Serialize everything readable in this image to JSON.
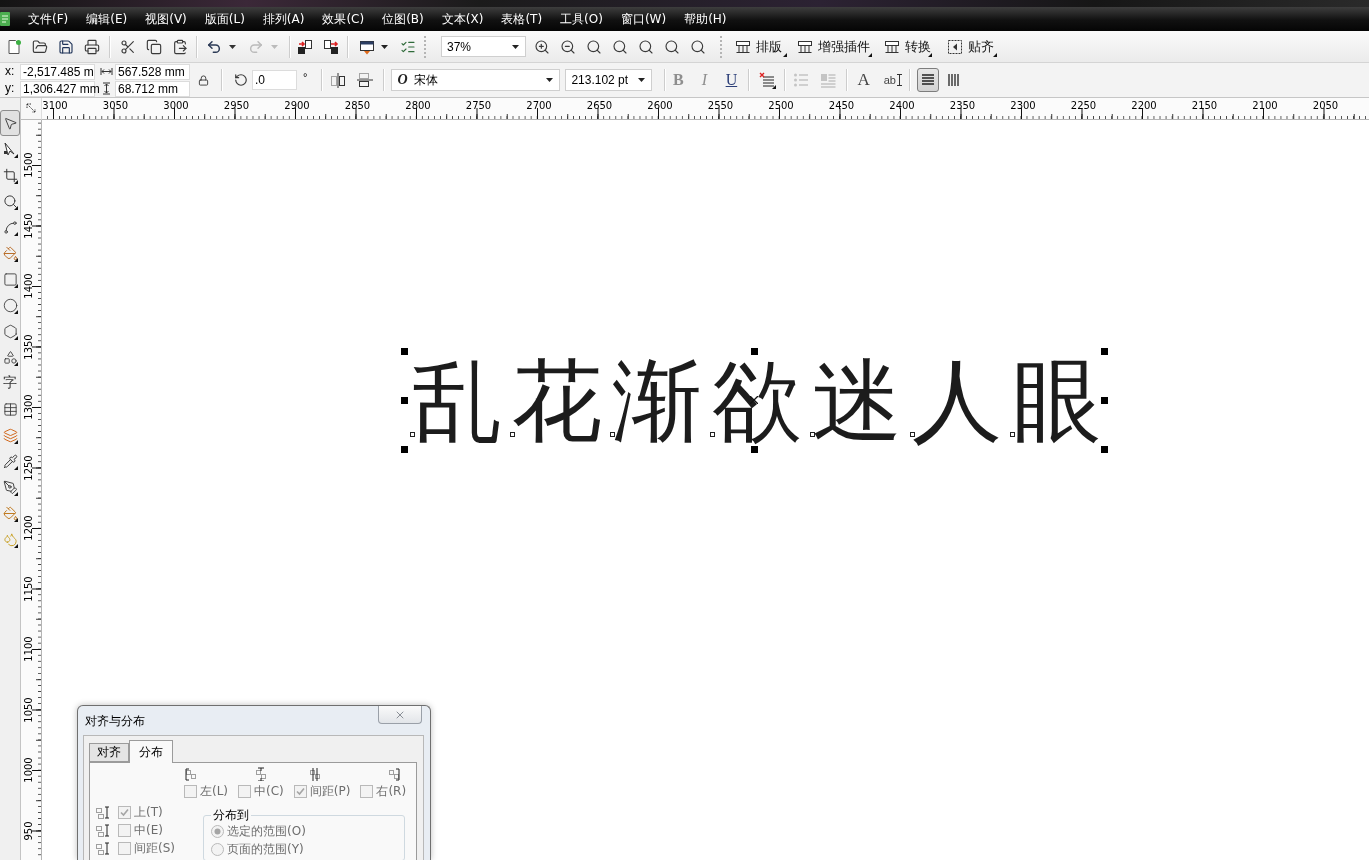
{
  "menu_bar": {
    "items": [
      "文件(F)",
      "编辑(E)",
      "视图(V)",
      "版面(L)",
      "排列(A)",
      "效果(C)",
      "位图(B)",
      "文本(X)",
      "表格(T)",
      "工具(O)",
      "窗口(W)",
      "帮助(H)"
    ]
  },
  "standard_toolbar": {
    "undo": {
      "disabled": false
    },
    "redo": {
      "disabled": true
    },
    "zoom_level": "37%",
    "plugin_buttons": [
      {
        "label": "排版"
      },
      {
        "label": "增强插件"
      },
      {
        "label": "转换"
      },
      {
        "label": "贴齐"
      }
    ]
  },
  "property_bar": {
    "x_label": "x:",
    "x": "-2,517.485 m",
    "y_label": "y:",
    "y": "1,306.427 mm",
    "width": "567.528 mm",
    "height": "68.712 mm",
    "rotation": ".0",
    "rotation_unit": "°",
    "font_type_symbol": "O",
    "font": "宋体",
    "font_size": "213.102 pt",
    "style_buttons": [
      {
        "label": "B",
        "disabled": true
      },
      {
        "label": "I",
        "disabled": true
      },
      {
        "label": "U",
        "disabled": false
      }
    ],
    "list_buttons": [
      {
        "disabled": true
      },
      {
        "disabled": true
      }
    ],
    "edit_text_buttons": [
      {
        "label": "A"
      },
      {
        "label": "ab"
      }
    ],
    "text_direction": [
      {
        "selected": true
      },
      {
        "selected": false
      }
    ]
  },
  "toolbox": {
    "tools": [
      {
        "selected": true,
        "flyout": false
      },
      {
        "selected": false,
        "flyout": true
      },
      {
        "selected": false,
        "flyout": true
      },
      {
        "selected": false,
        "flyout": true
      },
      {
        "selected": false,
        "flyout": true
      },
      {
        "selected": false,
        "flyout": true
      },
      {
        "selected": false,
        "flyout": true
      },
      {
        "selected": false,
        "flyout": true
      },
      {
        "selected": false,
        "flyout": true
      },
      {
        "selected": false,
        "flyout": true
      },
      {
        "label": "字",
        "selected": false,
        "flyout": false
      },
      {
        "selected": false,
        "flyout": false
      },
      {
        "selected": false,
        "flyout": true
      },
      {
        "selected": false,
        "flyout": true
      },
      {
        "selected": false,
        "flyout": true
      },
      {
        "selected": false,
        "flyout": true
      },
      {
        "selected": false,
        "flyout": true
      }
    ]
  },
  "horizontal_ruler": {
    "labels": [
      "3100",
      "3050",
      "3000",
      "2950",
      "2900",
      "2850",
      "2800",
      "2750",
      "2700",
      "2650",
      "2600",
      "2550",
      "2500",
      "2450",
      "2400",
      "2350",
      "2300",
      "2250",
      "2200",
      "2150",
      "2100",
      "2050"
    ]
  },
  "vertical_ruler": {
    "labels": [
      "1500",
      "1450",
      "1400",
      "1350",
      "1300",
      "1250",
      "1200",
      "1150",
      "1100",
      "1050",
      "1000",
      "950"
    ]
  },
  "canvas": {
    "text_object": {
      "text": "乱花渐欲迷人眼",
      "selected": true
    }
  },
  "dialog": {
    "title": "对齐与分布",
    "tabs": [
      {
        "label": "对齐",
        "selected": false
      },
      {
        "label": "分布",
        "selected": true
      }
    ],
    "horizontal_options": [
      {
        "label": "左(L)",
        "checked": false,
        "disabled": true
      },
      {
        "label": "中(C)",
        "checked": false,
        "disabled": true
      },
      {
        "label": "间距(P)",
        "checked": true,
        "disabled": true
      },
      {
        "label": "右(R)",
        "checked": false,
        "disabled": true
      }
    ],
    "vertical_options": [
      {
        "label": "上(T)",
        "checked": true,
        "disabled": true
      },
      {
        "label": "中(E)",
        "checked": false,
        "disabled": true
      },
      {
        "label": "间距(S)",
        "checked": false,
        "disabled": true
      }
    ],
    "distribute_to": {
      "title": "分布到",
      "options": [
        {
          "label": "选定的范围(O)",
          "selected": true,
          "disabled": true
        },
        {
          "label": "页面的范围(Y)",
          "selected": false,
          "disabled": true
        }
      ]
    }
  }
}
